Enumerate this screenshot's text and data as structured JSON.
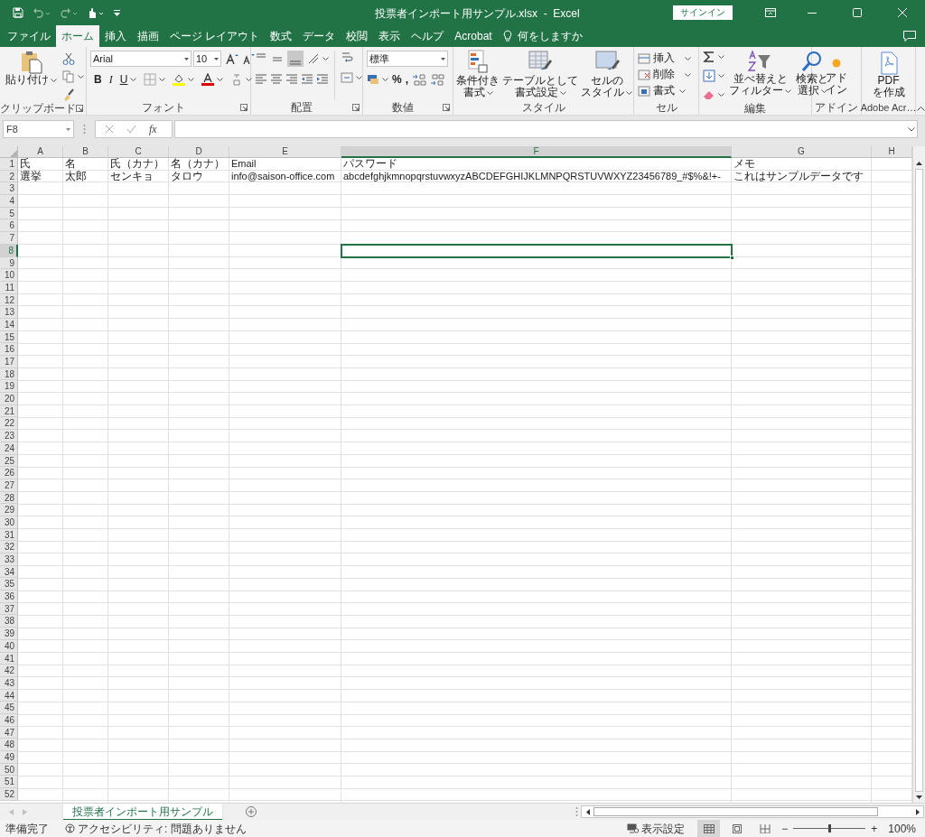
{
  "quick_access": [
    {
      "kind": "save",
      "disabled": false
    },
    {
      "kind": "undo",
      "disabled": true
    },
    {
      "kind": "redo",
      "disabled": true
    },
    {
      "kind": "touch",
      "disabled": false
    },
    {
      "kind": "customize",
      "disabled": false
    }
  ],
  "window": {
    "title": "投票者インポート用サンプル.xlsx  -  Excel",
    "sign_in": "サインイン"
  },
  "tabs": [
    {
      "label": "ファイル",
      "selected": false
    },
    {
      "label": "ホーム",
      "selected": true
    },
    {
      "label": "挿入",
      "selected": false
    },
    {
      "label": "描画",
      "selected": false
    },
    {
      "label": "ページ レイアウト",
      "selected": false
    },
    {
      "label": "数式",
      "selected": false
    },
    {
      "label": "データ",
      "selected": false
    },
    {
      "label": "校閲",
      "selected": false
    },
    {
      "label": "表示",
      "selected": false
    },
    {
      "label": "ヘルプ",
      "selected": false
    },
    {
      "label": "Acrobat",
      "selected": false
    }
  ],
  "tell_me": {
    "placeholder": "何をしますか"
  },
  "ribbon": [
    {
      "kind": "clipboard",
      "label": "クリップボード",
      "launcher": true,
      "paste": "貼り付け"
    },
    {
      "kind": "font",
      "label": "フォント",
      "launcher": true,
      "font_name": "Arial",
      "font_size": "10",
      "styles": [
        "B",
        "I",
        "U"
      ]
    },
    {
      "kind": "alignment",
      "label": "配置",
      "launcher": true
    },
    {
      "kind": "number",
      "label": "数値",
      "launcher": true,
      "format": "標準",
      "symbols": [
        "%",
        ","
      ]
    },
    {
      "kind": "styles",
      "label": "スタイル",
      "launcher": false,
      "buttons": [
        {
          "lines": [
            "条件付き",
            "書式"
          ]
        },
        {
          "lines": [
            "テーブルとして",
            "書式設定"
          ]
        },
        {
          "lines": [
            "セルの",
            "スタイル"
          ]
        }
      ]
    },
    {
      "kind": "cells",
      "label": "セル",
      "launcher": false,
      "buttons": [
        "挿入",
        "削除",
        "書式"
      ]
    },
    {
      "kind": "editing",
      "label": "編集",
      "launcher": false,
      "buttons": [
        {
          "lines": [
            "並べ替えと",
            "フィルター"
          ]
        },
        {
          "lines": [
            "検索と",
            "選択"
          ]
        }
      ]
    },
    {
      "kind": "addin",
      "label": "アドイン",
      "launcher": false,
      "buttons": [
        {
          "lines": [
            "アド",
            "イン"
          ]
        }
      ]
    },
    {
      "kind": "adobe",
      "label": "Adobe Acr…",
      "launcher": false,
      "buttons": [
        {
          "lines": [
            "PDF",
            "を作成"
          ]
        }
      ]
    }
  ],
  "formula_bar": {
    "name_box": "F8",
    "function_label": "fx"
  },
  "columns": [
    {
      "label": "A",
      "selected": false
    },
    {
      "label": "B",
      "selected": false
    },
    {
      "label": "C",
      "selected": false
    },
    {
      "label": "D",
      "selected": false
    },
    {
      "label": "E",
      "selected": false
    },
    {
      "label": "F",
      "selected": true
    },
    {
      "label": "G",
      "selected": false
    },
    {
      "label": "H",
      "selected": false
    }
  ],
  "rows": [
    {
      "label": "1",
      "selected": false,
      "cells": [
        "氏",
        "名",
        "氏（カナ）",
        "名（カナ）",
        "Email",
        "パスワード",
        "メモ"
      ]
    },
    {
      "label": "2",
      "selected": false,
      "cells": [
        "選挙",
        "太郎",
        "センキョ",
        "タロウ",
        "info@saison-office.com",
        "abcdefghjkmnopqrstuvwxyzABCDEFGHIJKLMNPQRSTUVWXYZ23456789_#$%&!+-",
        "これはサンプルデータです"
      ]
    },
    {
      "label": "3",
      "selected": false
    },
    {
      "label": "4",
      "selected": false
    },
    {
      "label": "5",
      "selected": false
    },
    {
      "label": "6",
      "selected": false
    },
    {
      "label": "7",
      "selected": false
    },
    {
      "label": "8",
      "selected": true
    },
    {
      "label": "9",
      "selected": false
    },
    {
      "label": "10",
      "selected": false
    },
    {
      "label": "11",
      "selected": false
    },
    {
      "label": "12",
      "selected": false
    },
    {
      "label": "13",
      "selected": false
    },
    {
      "label": "14",
      "selected": false
    },
    {
      "label": "15",
      "selected": false
    },
    {
      "label": "16",
      "selected": false
    },
    {
      "label": "17",
      "selected": false
    },
    {
      "label": "18",
      "selected": false
    },
    {
      "label": "19",
      "selected": false
    },
    {
      "label": "20",
      "selected": false
    },
    {
      "label": "21",
      "selected": false
    },
    {
      "label": "22",
      "selected": false
    },
    {
      "label": "23",
      "selected": false
    },
    {
      "label": "24",
      "selected": false
    },
    {
      "label": "25",
      "selected": false
    },
    {
      "label": "26",
      "selected": false
    },
    {
      "label": "27",
      "selected": false
    },
    {
      "label": "28",
      "selected": false
    },
    {
      "label": "29",
      "selected": false
    },
    {
      "label": "30",
      "selected": false
    },
    {
      "label": "31",
      "selected": false
    },
    {
      "label": "32",
      "selected": false
    },
    {
      "label": "33",
      "selected": false
    },
    {
      "label": "34",
      "selected": false
    },
    {
      "label": "35",
      "selected": false
    },
    {
      "label": "36",
      "selected": false
    },
    {
      "label": "37",
      "selected": false
    },
    {
      "label": "38",
      "selected": false
    },
    {
      "label": "39",
      "selected": false
    },
    {
      "label": "40",
      "selected": false
    },
    {
      "label": "41",
      "selected": false
    },
    {
      "label": "42",
      "selected": false
    },
    {
      "label": "43",
      "selected": false
    },
    {
      "label": "44",
      "selected": false
    },
    {
      "label": "45",
      "selected": false
    },
    {
      "label": "46",
      "selected": false
    },
    {
      "label": "47",
      "selected": false
    },
    {
      "label": "48",
      "selected": false
    },
    {
      "label": "49",
      "selected": false
    },
    {
      "label": "50",
      "selected": false
    },
    {
      "label": "51",
      "selected": false
    },
    {
      "label": "52",
      "selected": false
    }
  ],
  "sheet_tabs": [
    {
      "label": "投票者インポート用サンプル",
      "selected": true
    }
  ],
  "status_bar": {
    "ready": "準備完了",
    "accessibility": "アクセシビリティ: 問題ありません",
    "display_settings": "表示設定",
    "views": [
      {
        "kind": "normal",
        "selected": true
      },
      {
        "kind": "page_layout",
        "selected": false
      },
      {
        "kind": "page_break",
        "selected": false
      }
    ],
    "zoom": {
      "zoom_out": "−",
      "zoom_in": "+",
      "level": 0.5,
      "reading": "100%"
    }
  }
}
